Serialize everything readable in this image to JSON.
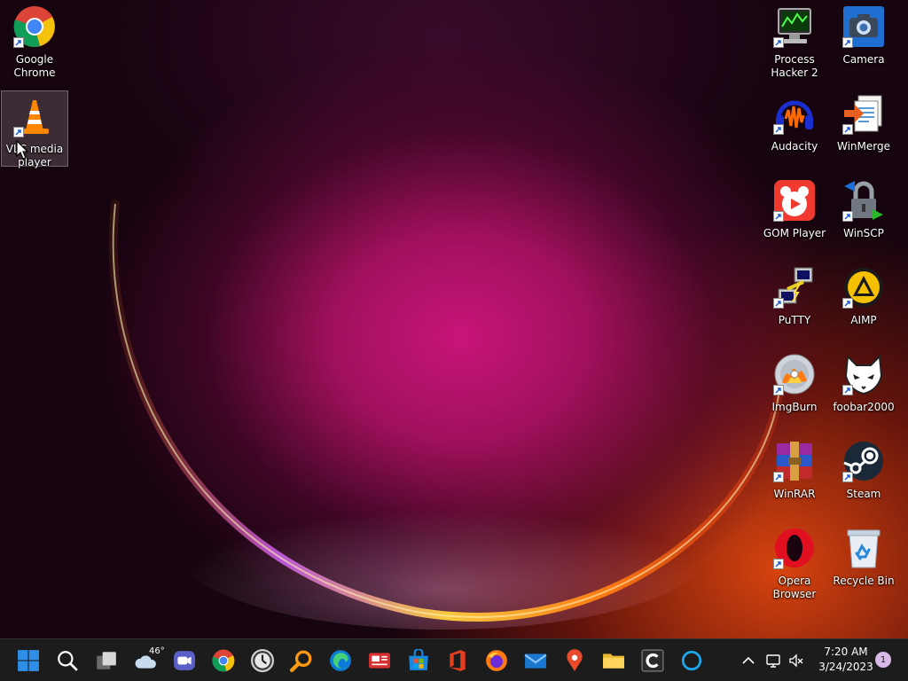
{
  "desktop": {
    "left_column": [
      {
        "name": "Google Chrome",
        "icon": "chrome-icon",
        "selected": false
      },
      {
        "name": "VLC media player",
        "icon": "vlc-icon",
        "selected": true
      }
    ],
    "right_icons": [
      {
        "name": "Process Hacker 2",
        "icon": "process-hacker-icon"
      },
      {
        "name": "Camera",
        "icon": "camera-icon"
      },
      {
        "name": "Audacity",
        "icon": "audacity-icon"
      },
      {
        "name": "WinMerge",
        "icon": "winmerge-icon"
      },
      {
        "name": "GOM Player",
        "icon": "gom-player-icon"
      },
      {
        "name": "WinSCP",
        "icon": "winscp-icon"
      },
      {
        "name": "PuTTY",
        "icon": "putty-icon"
      },
      {
        "name": "AIMP",
        "icon": "aimp-icon"
      },
      {
        "name": "ImgBurn",
        "icon": "imgburn-icon"
      },
      {
        "name": "foobar2000",
        "icon": "foobar2000-icon"
      },
      {
        "name": "WinRAR",
        "icon": "winrar-icon"
      },
      {
        "name": "Steam",
        "icon": "steam-icon"
      },
      {
        "name": "Opera Browser",
        "icon": "opera-icon"
      },
      {
        "name": "Recycle Bin",
        "icon": "recycle-bin-icon"
      }
    ]
  },
  "taskbar": {
    "weather": {
      "temperature": "46°",
      "icon": "cloud-icon"
    },
    "apps": [
      "start-icon",
      "search-icon",
      "task-view-icon",
      "weather-widget",
      "teams-chat-icon",
      "chrome-icon",
      "clock-app-icon",
      "magnifier-search-icon",
      "edge-icon",
      "news-app-icon",
      "store-icon",
      "office-icon",
      "firefox-icon",
      "mail-icon",
      "maps-icon",
      "file-explorer-icon",
      "ccleaner-icon",
      "cortana-icon"
    ],
    "tray": [
      "chevron-up-icon",
      "network-icon",
      "volume-muted-icon"
    ],
    "clock": {
      "time": "7:20 AM",
      "date": "3/24/2023"
    },
    "notifications": "1"
  },
  "colors": {
    "taskbar_bg": "#1c1c1c",
    "wallpaper_primary": "#c8157a",
    "wallpaper_glow": "#f0b020",
    "start_blue": "#2f8fe8"
  }
}
